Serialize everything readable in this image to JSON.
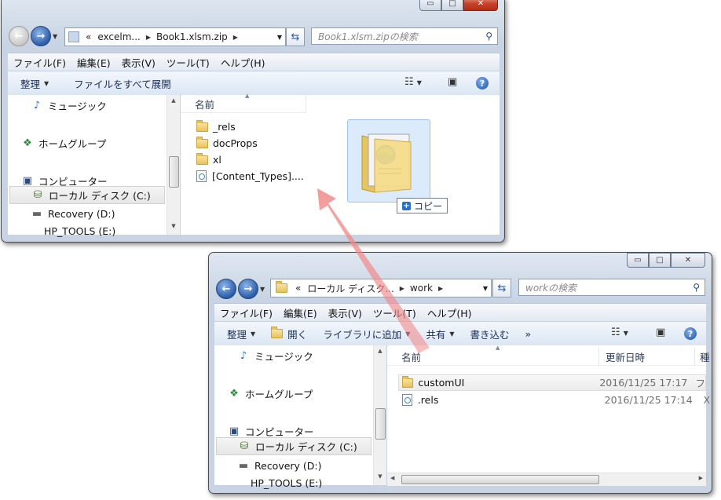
{
  "win1": {
    "caption_buttons": {
      "minimize": "▭",
      "maximize": "□",
      "close": "✕"
    },
    "address": {
      "overflow": "«",
      "segments": [
        "excelm...",
        "Book1.xlsm.zip"
      ]
    },
    "search_placeholder": "Book1.xlsm.zipの検索",
    "menu": [
      "ファイル(F)",
      "編集(E)",
      "表示(V)",
      "ツール(T)",
      "ヘルプ(H)"
    ],
    "toolbar": {
      "organize": "整理",
      "extract_all": "ファイルをすべて展開"
    },
    "nav": [
      "ミュージック",
      "ホームグループ",
      "コンピューター",
      "ローカル ディスク (C:)",
      "Recovery (D:)",
      "HP_TOOLS (E:)"
    ],
    "column_name": "名前",
    "files": [
      {
        "name": "_rels",
        "type": "folder"
      },
      {
        "name": "docProps",
        "type": "folder"
      },
      {
        "name": "xl",
        "type": "folder"
      },
      {
        "name": "[Content_Types]....",
        "type": "file"
      }
    ],
    "drag_tooltip": "コピー"
  },
  "win2": {
    "caption_buttons": {
      "minimize": "▭",
      "maximize": "□",
      "close": "✕"
    },
    "address": {
      "overflow": "«",
      "segments": [
        "ローカル ディスク...",
        "work"
      ]
    },
    "search_placeholder": "workの検索",
    "menu": [
      "ファイル(F)",
      "編集(E)",
      "表示(V)",
      "ツール(T)",
      "ヘルプ(H)"
    ],
    "toolbar": {
      "organize": "整理",
      "open": "開く",
      "library": "ライブラリに追加",
      "share": "共有",
      "burn": "書き込む",
      "more": "»"
    },
    "nav": [
      "ミュージック",
      "ホームグループ",
      "コンピューター",
      "ローカル ディスク (C:)",
      "Recovery (D:)",
      "HP_TOOLS (E:)"
    ],
    "columns": {
      "name": "名前",
      "date": "更新日時",
      "type": "種"
    },
    "files": [
      {
        "name": "customUI",
        "type": "folder",
        "date": "2016/11/25 17:17",
        "kind": "フ"
      },
      {
        "name": ".rels",
        "type": "file",
        "date": "2016/11/25 17:14",
        "kind": "X"
      }
    ]
  },
  "colors": {
    "drag_arrow": "#f08a8a",
    "accent": "#2a5ca8"
  }
}
